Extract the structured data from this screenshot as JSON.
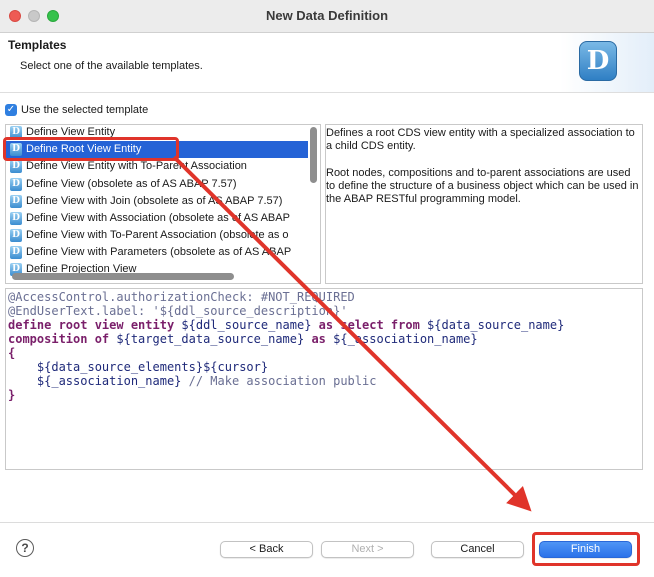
{
  "window": {
    "title": "New Data Definition"
  },
  "header": {
    "title": "Templates",
    "description": "Select one of the available templates.",
    "logo_letter": "D"
  },
  "use_template": {
    "label": "Use the selected template",
    "checked": true
  },
  "templates": [
    {
      "label": "Define View Entity",
      "selected": false
    },
    {
      "label": "Define Root View Entity",
      "selected": true
    },
    {
      "label": "Define View Entity with To-Parent Association",
      "selected": false
    },
    {
      "label": "Define View (obsolete as of AS ABAP 7.57)",
      "selected": false
    },
    {
      "label": "Define View with Join (obsolete as of AS ABAP 7.57)",
      "selected": false
    },
    {
      "label": "Define View with Association (obsolete as of AS ABAP",
      "selected": false
    },
    {
      "label": "Define View with To-Parent Association (obsolete as o",
      "selected": false
    },
    {
      "label": "Define View with Parameters (obsolete as of AS ABAP",
      "selected": false
    },
    {
      "label": "Define Projection View",
      "selected": false
    }
  ],
  "template_description": {
    "p1": "Defines a root CDS view entity with a specialized association to a child CDS entity.",
    "p2": "Root nodes, compositions and to-parent associations are used to define the structure of a business object which can be used in the ABAP RESTful programming model."
  },
  "code": {
    "line1": "@AccessControl.authorizationCheck: #NOT_REQUIRED",
    "line2": "@EndUserText.label: '${ddl_source_description}'",
    "line3_kw1": "define root view entity",
    "line3_ph1": " ${ddl_source_name} ",
    "line3_kw2": "as select from",
    "line3_ph2": " ${data_source_name}",
    "line4_kw1": "composition of",
    "line4_ph1": " ${target_data_source_name} ",
    "line4_kw2": "as",
    "line4_ph2": " ${_association_name}",
    "line5": "{",
    "line6": "    ${data_source_elements}${cursor}",
    "line7_ph": "    ${_association_name}",
    "line7_comment": " // Make association public",
    "line8": "}"
  },
  "buttons": {
    "help": "?",
    "back": "< Back",
    "next": "Next >",
    "cancel": "Cancel",
    "finish": "Finish"
  },
  "colors": {
    "selection": "#2563d6",
    "annotation_red": "#e0342a",
    "primary_button": "#2b72ea"
  }
}
